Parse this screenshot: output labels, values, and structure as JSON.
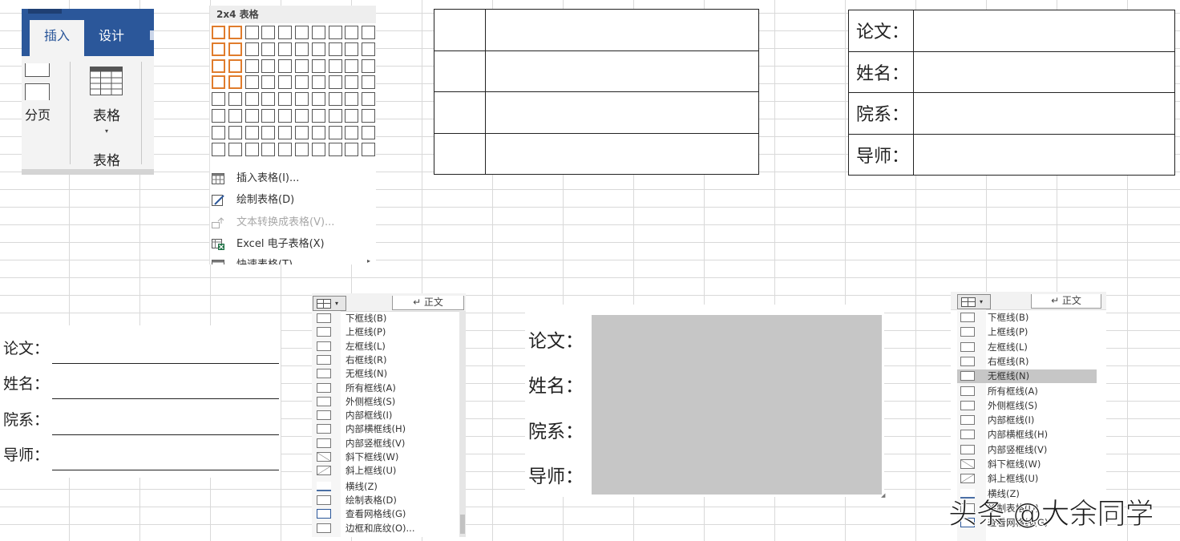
{
  "ribbon": {
    "tabs": [
      {
        "label": "插入"
      },
      {
        "label": "设计"
      }
    ],
    "page_break_label": "分页",
    "table_button_label": "表格",
    "table_caret": "▾",
    "group_label": "表格"
  },
  "insert_table_menu": {
    "grid_header": "2x4 表格",
    "grid_columns": 10,
    "grid_rows": 8,
    "selected_columns": 2,
    "selected_rows": 4,
    "items": [
      {
        "label": "插入表格(I)...",
        "icon": "table-icon",
        "enabled": true
      },
      {
        "label": "绘制表格(D)",
        "icon": "pencil-table-icon",
        "enabled": true
      },
      {
        "label": "文本转换成表格(V)...",
        "icon": "convert-text-icon",
        "enabled": false
      },
      {
        "label": "Excel 电子表格(X)",
        "icon": "excel-icon",
        "enabled": true
      },
      {
        "label": "快速表格(T)",
        "icon": "quick-table-icon",
        "enabled": true,
        "submenu": true
      }
    ],
    "submenu_arrow": "▸"
  },
  "blank_table": {
    "rows": 4,
    "columns": 2
  },
  "form_labels": [
    "论文：",
    "姓名：",
    "院系：",
    "导师："
  ],
  "border_menu_left": {
    "style_label": "↵ 正文",
    "items": [
      {
        "label": "下框线(B)",
        "icon": "bottom-border-icon"
      },
      {
        "label": "上框线(P)",
        "icon": "top-border-icon"
      },
      {
        "label": "左框线(L)",
        "icon": "left-border-icon"
      },
      {
        "label": "右框线(R)",
        "icon": "right-border-icon"
      },
      {
        "label": "无框线(N)",
        "icon": "no-border-icon"
      },
      {
        "label": "所有框线(A)",
        "icon": "all-borders-icon"
      },
      {
        "label": "外侧框线(S)",
        "icon": "outside-borders-icon"
      },
      {
        "label": "内部框线(I)",
        "icon": "inside-borders-icon"
      },
      {
        "label": "内部横框线(H)",
        "icon": "inside-horizontal-border-icon"
      },
      {
        "label": "内部竖框线(V)",
        "icon": "inside-vertical-border-icon"
      },
      {
        "label": "斜下框线(W)",
        "icon": "diagonal-down-border-icon"
      },
      {
        "label": "斜上框线(U)",
        "icon": "diagonal-up-border-icon"
      },
      {
        "label": "横线(Z)",
        "icon": "horizontal-line-icon"
      },
      {
        "label": "绘制表格(D)",
        "icon": "draw-table-icon"
      },
      {
        "label": "查看网格线(G)",
        "icon": "view-gridlines-icon"
      },
      {
        "label": "边框和底纹(O)...",
        "icon": "borders-shading-icon"
      }
    ]
  },
  "border_menu_right": {
    "style_label": "↵ 正文",
    "selected": "无框线(N)",
    "items": [
      {
        "label": "下框线(B)",
        "icon": "bottom-border-icon"
      },
      {
        "label": "上框线(P)",
        "icon": "top-border-icon"
      },
      {
        "label": "左框线(L)",
        "icon": "left-border-icon"
      },
      {
        "label": "右框线(R)",
        "icon": "right-border-icon"
      },
      {
        "label": "无框线(N)",
        "icon": "no-border-icon"
      },
      {
        "label": "所有框线(A)",
        "icon": "all-borders-icon"
      },
      {
        "label": "外侧框线(S)",
        "icon": "outside-borders-icon"
      },
      {
        "label": "内部框线(I)",
        "icon": "inside-borders-icon"
      },
      {
        "label": "内部横框线(H)",
        "icon": "inside-horizontal-border-icon"
      },
      {
        "label": "内部竖框线(V)",
        "icon": "inside-vertical-border-icon"
      },
      {
        "label": "斜下框线(W)",
        "icon": "diagonal-down-border-icon"
      },
      {
        "label": "斜上框线(U)",
        "icon": "diagonal-up-border-icon"
      },
      {
        "label": "横线(Z)",
        "icon": "horizontal-line-icon"
      },
      {
        "label": "绘制表格(D)",
        "icon": "draw-table-icon"
      },
      {
        "label": "查看网格线(G)",
        "icon": "view-gridlines-icon"
      }
    ]
  },
  "watermark": "头条 @大余同学",
  "colors": {
    "ribbon_blue": "#2b579a",
    "grid_highlight": "#e07c2c",
    "shading_gray": "#c6c6c6",
    "menu_selected": "#c6c6c6",
    "excel_green": "#1e7145"
  }
}
